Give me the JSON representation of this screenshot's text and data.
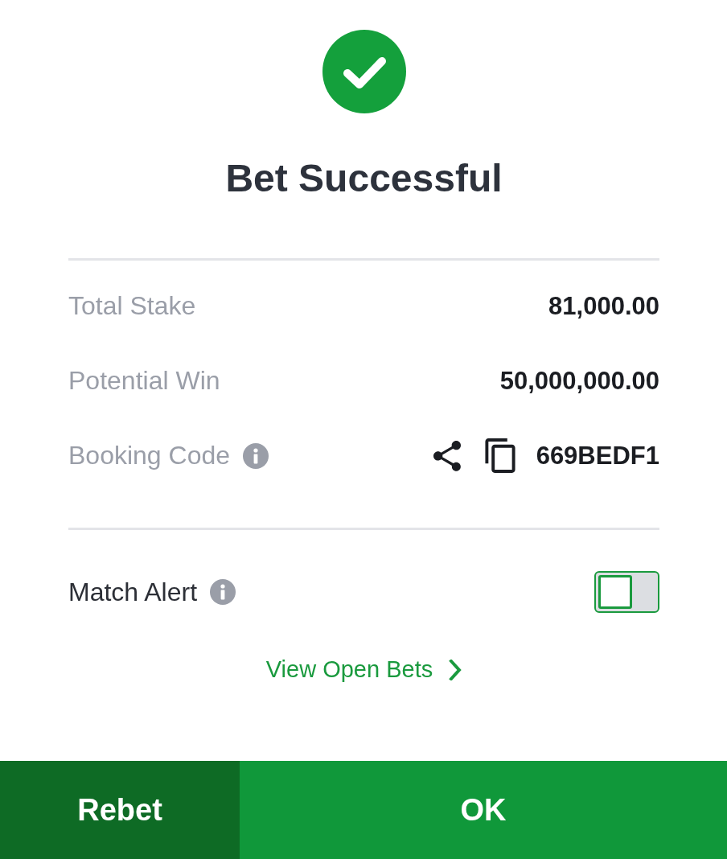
{
  "header": {
    "title": "Bet Successful"
  },
  "summary": [
    {
      "kind": "plain",
      "label": "Total Stake",
      "value": "81,000.00"
    },
    {
      "kind": "plain",
      "label": "Potential Win",
      "value": "50,000,000.00"
    },
    {
      "kind": "code",
      "label": "Booking Code",
      "value": "669BEDF1"
    }
  ],
  "match_alert": {
    "label": "Match Alert",
    "on": false
  },
  "open_bets_link": {
    "label": "View Open Bets"
  },
  "buttons": [
    {
      "kind": "secondary",
      "label": "Rebet"
    },
    {
      "kind": "primary",
      "label": "OK"
    }
  ]
}
